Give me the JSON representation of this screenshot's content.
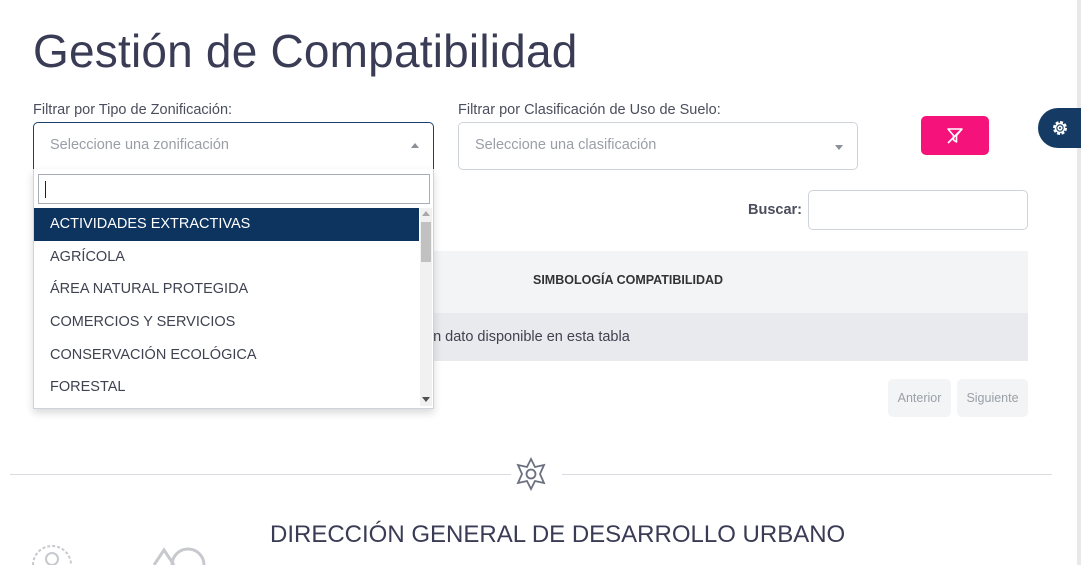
{
  "page": {
    "title": "Gestión de Compatibilidad"
  },
  "filters": {
    "zonificacion": {
      "label": "Filtrar por Tipo de Zonificación:",
      "placeholder": "Seleccione una zonificación",
      "open": true
    },
    "clasificacion": {
      "label": "Filtrar por Clasificación de Uso de Suelo:",
      "placeholder": "Seleccione una clasificación"
    },
    "clear_button_icon": "filter-clear-icon"
  },
  "dropdown": {
    "search_value": "",
    "items": [
      "ACTIVIDADES EXTRACTIVAS",
      "AGRÍCOLA",
      "ÁREA NATURAL PROTEGIDA",
      "COMERCIOS Y SERVICIOS",
      "CONSERVACIÓN ECOLÓGICA",
      "FORESTAL"
    ],
    "highlighted_index": 0
  },
  "search": {
    "label": "Buscar:",
    "value": ""
  },
  "table": {
    "header": "SIMBOLOGÍA COMPATIBILIDAD",
    "empty_message": "ún dato disponible en esta tabla"
  },
  "pagination": {
    "prev_label": "Anterior",
    "next_label": "Siguiente"
  },
  "footer": {
    "title": "DIRECCIÓN GENERAL DE DESARROLLO URBANO",
    "emblem_icon": "star-emblem-icon"
  },
  "colors": {
    "accent": "#f5127b",
    "navy": "#0d335f",
    "settings": "#153a63",
    "title": "#3a3c55"
  },
  "settings_icon": "gear-icon"
}
